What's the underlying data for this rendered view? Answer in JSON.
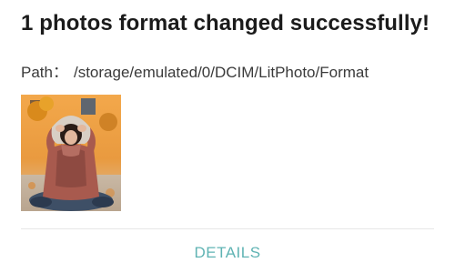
{
  "dialog": {
    "title": "1 photos format changed successfully!",
    "path_label": "Path：",
    "path_value": "/storage/emulated/0/DCIM/LitPhoto/Format",
    "thumbnail_icon": "photo-thumbnail",
    "details_label": "DETAILS"
  },
  "colors": {
    "title_text": "#1b1b1b",
    "path_text": "#3a3a3a",
    "details_accent": "#5fb3b3",
    "divider": "#e6e6e6"
  }
}
